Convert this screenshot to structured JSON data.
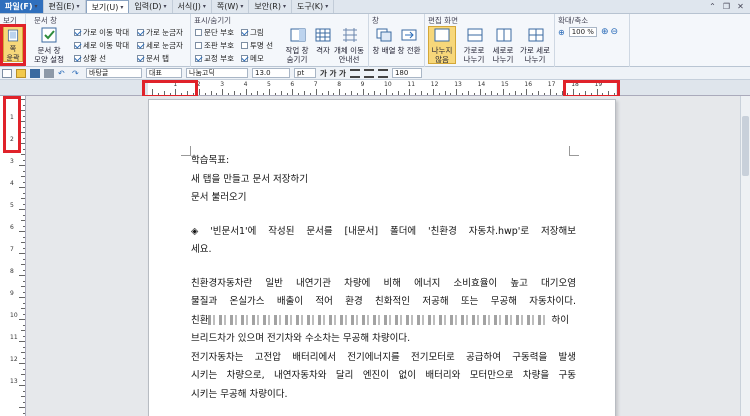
{
  "menu": {
    "items": [
      "파일(F)",
      "편집(E)",
      "보기(U)",
      "입력(D)",
      "서식(J)",
      "쪽(W)",
      "보안(R)",
      "도구(K)"
    ],
    "active_index": 2
  },
  "ribbon": {
    "groups": {
      "view": "보기",
      "doc_frame": "문서 창",
      "marks": "표시/숨기기",
      "window": "창",
      "split": "편집 화면",
      "zoom": "확대/축소"
    },
    "fit_button": "쪽 윤곽",
    "doc_frame_button": [
      "문서 창",
      "모양 설정"
    ],
    "checkboxes": {
      "horiz_scroll": "가로 이동 막대",
      "vert_scroll": "세로 이동 막대",
      "status_bar": "상황 선",
      "horiz_ruler": "가로 눈금자",
      "vert_ruler": "세로 눈금자",
      "tab": "문서 탭",
      "para_mark": "문단 부호",
      "grid": "그림",
      "obj_mark": "조판 부호",
      "transparent_line": "투명 선",
      "memo": "교정 부호",
      "memo2": "메모"
    },
    "window_buttons": [
      "작업 창 숨기기",
      "격자",
      "개체 이동 안내선"
    ],
    "arrange_buttons": [
      "창 배열",
      "창 전환"
    ],
    "split_buttons": [
      "나누지 않음",
      "가로로 나누기",
      "세로로 나누기",
      "가로 세로 나누기"
    ],
    "zoom_value": "100 %"
  },
  "toolbar": {
    "style": "바탕글",
    "lang": "대표",
    "font": "나눔고딕",
    "size": "13.0",
    "unit": "pt",
    "bold_italic_underline": "가 가 가",
    "line_spacing": "180"
  },
  "ruler": {
    "h_numbers": [
      "1",
      "2",
      "3",
      "4",
      "5",
      "6",
      "7",
      "8",
      "9",
      "10",
      "11",
      "12",
      "13",
      "14",
      "15",
      "16",
      "17",
      "18",
      "19"
    ],
    "v_numbers": [
      "1",
      "2",
      "3",
      "4",
      "5",
      "6",
      "7",
      "8",
      "9",
      "10",
      "11",
      "12",
      "13"
    ]
  },
  "document": {
    "lines": [
      "학습목표:",
      "새 탭을 만들고 문서 저장하기",
      "문서 불러오기"
    ],
    "para1": [
      "◈ '빈문서1'에 작성된 문서를 [내문서] 폴더에 '친환경 자동차.hwp'로 저장해보",
      "세요."
    ],
    "para2": [
      "친환경자동차란 일반 내연기관 차량에 비해 에너지 소비효율이 높고 대기오염",
      "물질과 온실가스 배출이 적어 환경 친화적인 저공해 또는 무공해 자동차이다.",
      "친환",
      "하이",
      "브리드차가 있으며 전기차와 수소차는 무공해 차량이다.",
      "전기자동차는 고전압 배터리에서 전기에너지를 전기모터로 공급하여 구동력을 발생",
      "시키는 차량으로, 내연자동차와 달리 엔진이 없이 배터리와 모터만으로 차량을 구동",
      "시키는 무공해 차량이다."
    ]
  },
  "colors": {
    "highlight": "#e0222a",
    "file_menu": "#2f6fbd"
  }
}
